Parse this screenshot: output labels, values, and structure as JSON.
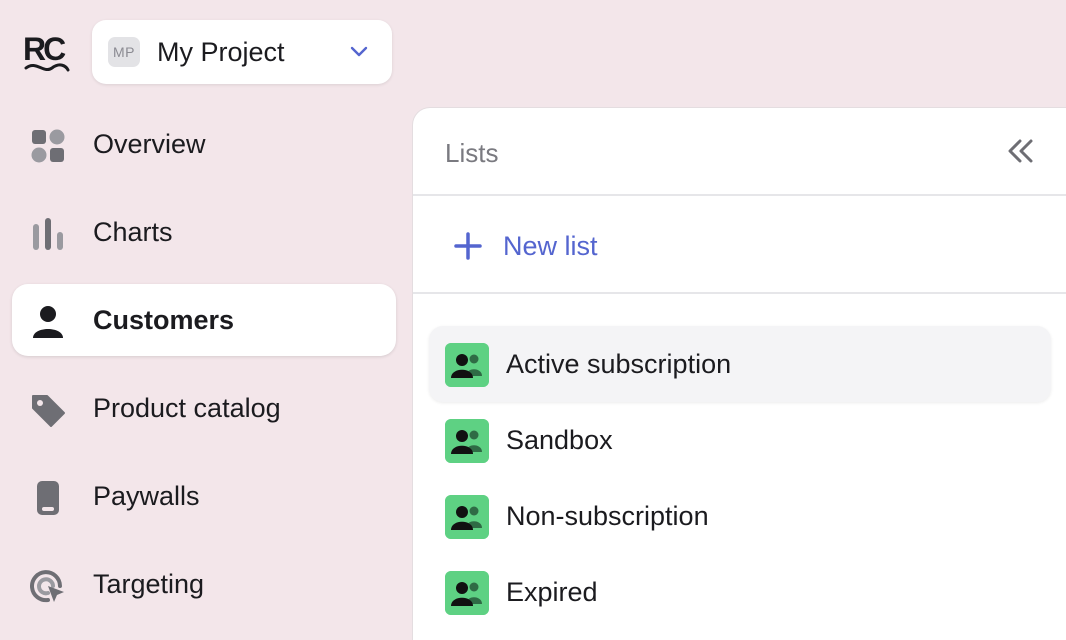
{
  "logo": {
    "text": "RC"
  },
  "project": {
    "initials": "MP",
    "name": "My Project"
  },
  "sidebar": {
    "items": [
      {
        "label": "Overview",
        "icon": "grid-icon"
      },
      {
        "label": "Charts",
        "icon": "chart-bars-icon"
      },
      {
        "label": "Customers",
        "icon": "person-icon",
        "active": true
      },
      {
        "label": "Product catalog",
        "icon": "tag-icon"
      },
      {
        "label": "Paywalls",
        "icon": "phone-icon"
      },
      {
        "label": "Targeting",
        "icon": "target-cursor-icon"
      }
    ]
  },
  "panel": {
    "title": "Lists",
    "new_list_label": "New list",
    "lists": [
      {
        "label": "Active subscription",
        "selected": true
      },
      {
        "label": "Sandbox"
      },
      {
        "label": "Non-subscription"
      },
      {
        "label": "Expired"
      }
    ]
  },
  "colors": {
    "background": "#f3e6ea",
    "accent": "#5465cf",
    "list_icon_bg": "#5ed183"
  }
}
